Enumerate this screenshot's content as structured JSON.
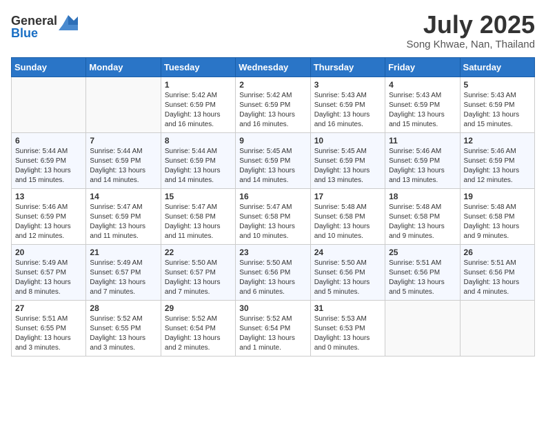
{
  "logo": {
    "general": "General",
    "blue": "Blue"
  },
  "title": {
    "month_year": "July 2025",
    "location": "Song Khwae, Nan, Thailand"
  },
  "days_of_week": [
    "Sunday",
    "Monday",
    "Tuesday",
    "Wednesday",
    "Thursday",
    "Friday",
    "Saturday"
  ],
  "weeks": [
    [
      {
        "day": "",
        "info": ""
      },
      {
        "day": "",
        "info": ""
      },
      {
        "day": "1",
        "info": "Sunrise: 5:42 AM\nSunset: 6:59 PM\nDaylight: 13 hours and 16 minutes."
      },
      {
        "day": "2",
        "info": "Sunrise: 5:42 AM\nSunset: 6:59 PM\nDaylight: 13 hours and 16 minutes."
      },
      {
        "day": "3",
        "info": "Sunrise: 5:43 AM\nSunset: 6:59 PM\nDaylight: 13 hours and 16 minutes."
      },
      {
        "day": "4",
        "info": "Sunrise: 5:43 AM\nSunset: 6:59 PM\nDaylight: 13 hours and 15 minutes."
      },
      {
        "day": "5",
        "info": "Sunrise: 5:43 AM\nSunset: 6:59 PM\nDaylight: 13 hours and 15 minutes."
      }
    ],
    [
      {
        "day": "6",
        "info": "Sunrise: 5:44 AM\nSunset: 6:59 PM\nDaylight: 13 hours and 15 minutes."
      },
      {
        "day": "7",
        "info": "Sunrise: 5:44 AM\nSunset: 6:59 PM\nDaylight: 13 hours and 14 minutes."
      },
      {
        "day": "8",
        "info": "Sunrise: 5:44 AM\nSunset: 6:59 PM\nDaylight: 13 hours and 14 minutes."
      },
      {
        "day": "9",
        "info": "Sunrise: 5:45 AM\nSunset: 6:59 PM\nDaylight: 13 hours and 14 minutes."
      },
      {
        "day": "10",
        "info": "Sunrise: 5:45 AM\nSunset: 6:59 PM\nDaylight: 13 hours and 13 minutes."
      },
      {
        "day": "11",
        "info": "Sunrise: 5:46 AM\nSunset: 6:59 PM\nDaylight: 13 hours and 13 minutes."
      },
      {
        "day": "12",
        "info": "Sunrise: 5:46 AM\nSunset: 6:59 PM\nDaylight: 13 hours and 12 minutes."
      }
    ],
    [
      {
        "day": "13",
        "info": "Sunrise: 5:46 AM\nSunset: 6:59 PM\nDaylight: 13 hours and 12 minutes."
      },
      {
        "day": "14",
        "info": "Sunrise: 5:47 AM\nSunset: 6:59 PM\nDaylight: 13 hours and 11 minutes."
      },
      {
        "day": "15",
        "info": "Sunrise: 5:47 AM\nSunset: 6:58 PM\nDaylight: 13 hours and 11 minutes."
      },
      {
        "day": "16",
        "info": "Sunrise: 5:47 AM\nSunset: 6:58 PM\nDaylight: 13 hours and 10 minutes."
      },
      {
        "day": "17",
        "info": "Sunrise: 5:48 AM\nSunset: 6:58 PM\nDaylight: 13 hours and 10 minutes."
      },
      {
        "day": "18",
        "info": "Sunrise: 5:48 AM\nSunset: 6:58 PM\nDaylight: 13 hours and 9 minutes."
      },
      {
        "day": "19",
        "info": "Sunrise: 5:48 AM\nSunset: 6:58 PM\nDaylight: 13 hours and 9 minutes."
      }
    ],
    [
      {
        "day": "20",
        "info": "Sunrise: 5:49 AM\nSunset: 6:57 PM\nDaylight: 13 hours and 8 minutes."
      },
      {
        "day": "21",
        "info": "Sunrise: 5:49 AM\nSunset: 6:57 PM\nDaylight: 13 hours and 7 minutes."
      },
      {
        "day": "22",
        "info": "Sunrise: 5:50 AM\nSunset: 6:57 PM\nDaylight: 13 hours and 7 minutes."
      },
      {
        "day": "23",
        "info": "Sunrise: 5:50 AM\nSunset: 6:56 PM\nDaylight: 13 hours and 6 minutes."
      },
      {
        "day": "24",
        "info": "Sunrise: 5:50 AM\nSunset: 6:56 PM\nDaylight: 13 hours and 5 minutes."
      },
      {
        "day": "25",
        "info": "Sunrise: 5:51 AM\nSunset: 6:56 PM\nDaylight: 13 hours and 5 minutes."
      },
      {
        "day": "26",
        "info": "Sunrise: 5:51 AM\nSunset: 6:56 PM\nDaylight: 13 hours and 4 minutes."
      }
    ],
    [
      {
        "day": "27",
        "info": "Sunrise: 5:51 AM\nSunset: 6:55 PM\nDaylight: 13 hours and 3 minutes."
      },
      {
        "day": "28",
        "info": "Sunrise: 5:52 AM\nSunset: 6:55 PM\nDaylight: 13 hours and 3 minutes."
      },
      {
        "day": "29",
        "info": "Sunrise: 5:52 AM\nSunset: 6:54 PM\nDaylight: 13 hours and 2 minutes."
      },
      {
        "day": "30",
        "info": "Sunrise: 5:52 AM\nSunset: 6:54 PM\nDaylight: 13 hours and 1 minute."
      },
      {
        "day": "31",
        "info": "Sunrise: 5:53 AM\nSunset: 6:53 PM\nDaylight: 13 hours and 0 minutes."
      },
      {
        "day": "",
        "info": ""
      },
      {
        "day": "",
        "info": ""
      }
    ]
  ]
}
